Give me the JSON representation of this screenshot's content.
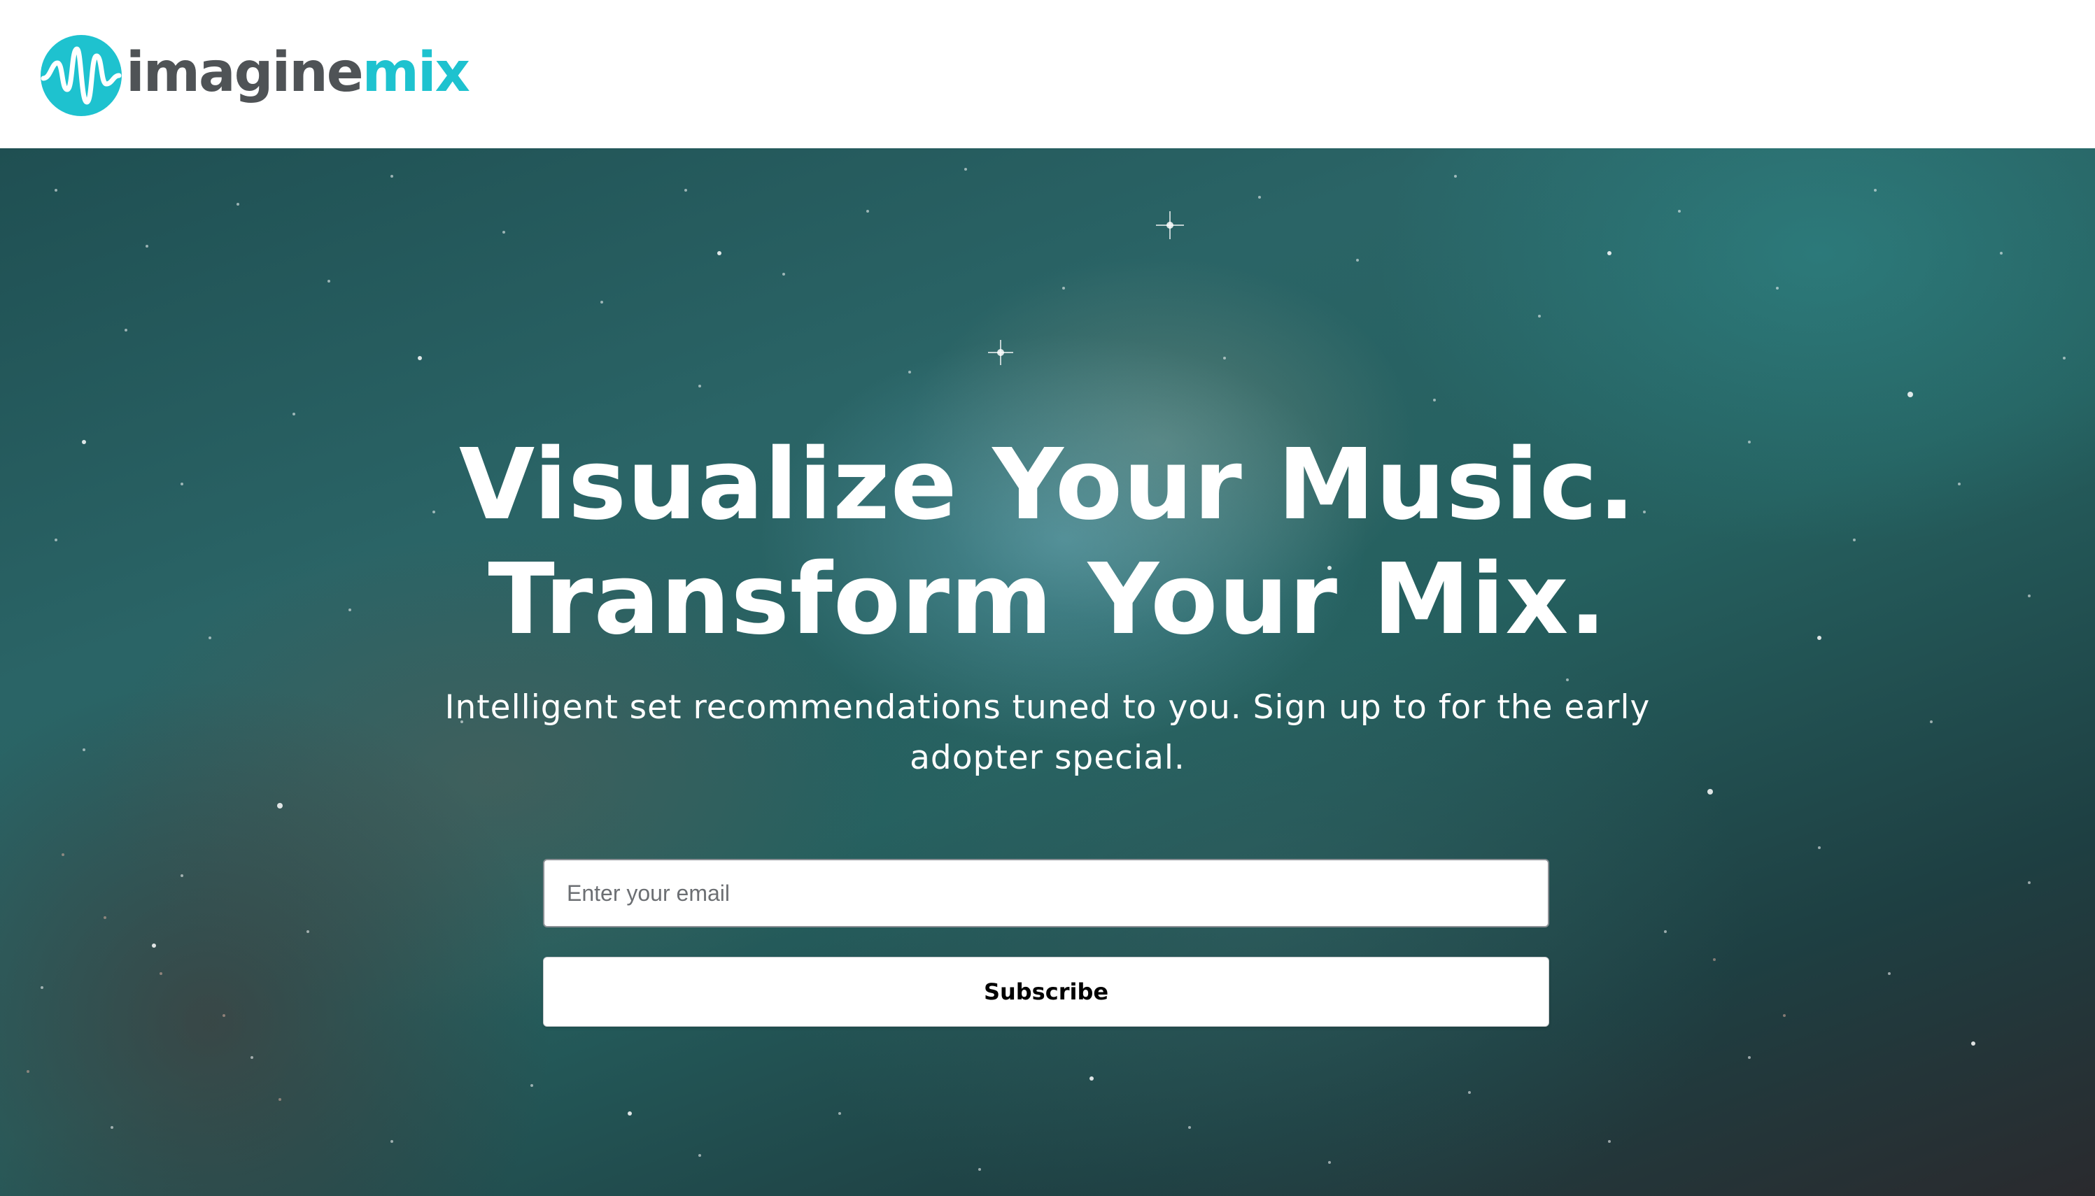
{
  "brand": {
    "name_part1": "imagine",
    "name_part2": "mix",
    "color_dark": "#4f5356",
    "color_accent": "#1ec2cf"
  },
  "hero": {
    "headline_line1": "Visualize Your Music.",
    "headline_line2": "Transform Your Mix.",
    "subtext": "Intelligent set recommendations tuned to you. Sign up to for the early adopter special."
  },
  "signup": {
    "email_placeholder": "Enter your email",
    "email_value": "",
    "button_label": "Subscribe"
  },
  "icons": {
    "logo": "waveform-circle-icon"
  }
}
